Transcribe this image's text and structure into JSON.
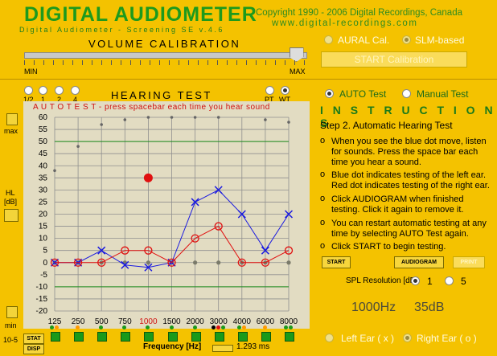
{
  "header": {
    "title": "DIGITAL AUDIOMETER",
    "subtitle": "Digital Audiometer - Screening SE v.4.6",
    "copyright": "Copyright 1990 - 2006 Digital Recordings, Canada",
    "website": "www.digital-recordings.com"
  },
  "volume": {
    "label": "VOLUME CALIBRATION",
    "min": "MIN",
    "max": "MAX",
    "level_fraction": 0.97
  },
  "calibration": {
    "aural_label": "AURAL Cal.",
    "slm_label": "SLM-based",
    "start_label": "START Calibration"
  },
  "hearing": {
    "title": "HEARING TEST",
    "step_options": [
      "1/2",
      "1",
      "2",
      "4"
    ],
    "pt_label": "PT",
    "wt_label": "WT",
    "side_max": "max",
    "side_hl": "HL",
    "side_db": "[dB]",
    "side_min": "min",
    "side_10_5": "10-5",
    "stat_label": "STAT",
    "disp_label": "DISP",
    "freq_label": "Frequency [Hz]",
    "duration": "1.293 ms",
    "auto_banner": "A U T O   T E S T - press spacebar each time you hear sound"
  },
  "mode": {
    "auto_label": "AUTO Test",
    "manual_label": "Manual Test",
    "selected": "auto"
  },
  "instructions": {
    "heading": "I N S T R U C T I O N S",
    "step": "Step 2.  Automatic Hearing Test",
    "items": [
      "When you see the blue dot move, listen for sounds. Press the space bar each time you hear a sound.",
      "Blue dot indicates testing of the left ear. Red dot indicates testing of the right ear.",
      "Click AUDIOGRAM when finished testing. Click it again to remove it.",
      "You can restart automatic testing at any time by selecting AUTO Test again.",
      "Click START to begin testing."
    ]
  },
  "buttons": {
    "start": "START",
    "audiogram": "AUDIOGRAM",
    "print": "PRINT"
  },
  "spl": {
    "label": "SPL Resolution [dB]",
    "opt1": "1",
    "opt5": "5",
    "selected": "1"
  },
  "readout": {
    "freq": "1000Hz",
    "level": "35dB"
  },
  "ears": {
    "left": "Left Ear ( x )",
    "right": "Right Ear ( o )",
    "selected": "right"
  },
  "colors": {
    "left_ear": "#1a1ae0",
    "right_ear": "#e01010",
    "norm_line": "#1b8a1b",
    "grid": "#8f8f8f",
    "background": "#f4c200"
  },
  "chart_data": {
    "type": "line",
    "categories": [
      "125",
      "250",
      "500",
      "750",
      "1000",
      "1500",
      "2000",
      "3000",
      "4000",
      "6000",
      "8000"
    ],
    "ylim": [
      -20,
      60
    ],
    "yticks": [
      "60",
      "55",
      "50",
      "45",
      "40",
      "35",
      "30",
      "25",
      "20",
      "15",
      "10",
      "5",
      "0",
      "-5",
      "-10",
      "-15",
      "-20"
    ],
    "reference_lines": [
      50,
      -10
    ],
    "series": [
      {
        "values": [
          0,
          0,
          5,
          -1,
          -2,
          0,
          25,
          30,
          20,
          5,
          20
        ],
        "marker": "x",
        "color": "#1a1ae0"
      },
      {
        "values": [
          0,
          0,
          0,
          5,
          5,
          0,
          10,
          15,
          0,
          0,
          5
        ],
        "marker": "o",
        "color": "#e01010"
      }
    ],
    "gray_dots": [
      38,
      48,
      57,
      59,
      60,
      60,
      60,
      60,
      62,
      59,
      58
    ],
    "zero_dots": [
      0,
      0,
      0,
      0,
      0,
      0,
      0,
      0,
      0,
      0,
      0
    ],
    "current_test": {
      "frequency": "1000",
      "level": 35
    }
  }
}
